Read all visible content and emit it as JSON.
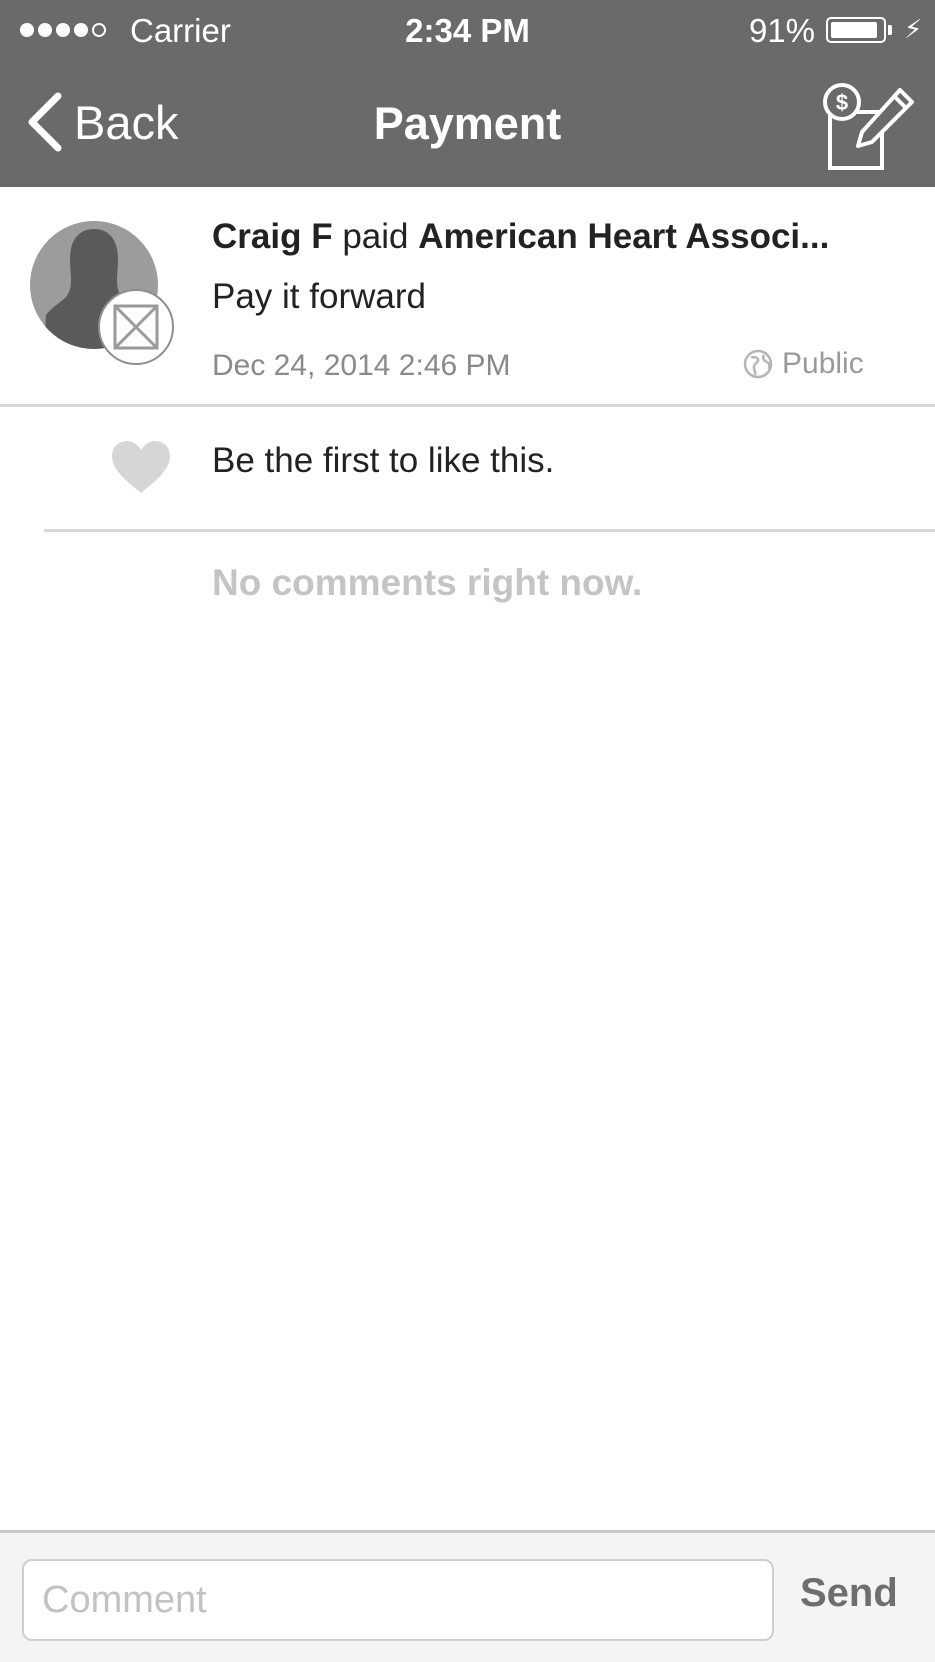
{
  "status_bar": {
    "carrier": "Carrier",
    "time": "2:34 PM",
    "battery_percent": "91%",
    "battery_level": 0.91,
    "signal_bars": 4
  },
  "nav": {
    "back_label": "Back",
    "title": "Payment",
    "action_icon": "pay-compose-icon"
  },
  "story": {
    "actor": "Craig F",
    "verb": "paid",
    "target": "American Heart Associ...",
    "note": "Pay it forward",
    "date": "Dec 24, 2014 2:46 PM",
    "audience": "Public",
    "avatar_icon": "person-silhouette-icon",
    "badge_icon": "image-placeholder-icon"
  },
  "likes": {
    "text": "Be the first to like this.",
    "icon": "heart-icon"
  },
  "comments": {
    "empty_text": "No comments right now."
  },
  "comment_bar": {
    "placeholder": "Comment",
    "value": "",
    "send_label": "Send"
  },
  "colors": {
    "nav_background": "#6a6a6a",
    "divider": "#d9d9d9",
    "muted_text": "#8a8a8a"
  }
}
